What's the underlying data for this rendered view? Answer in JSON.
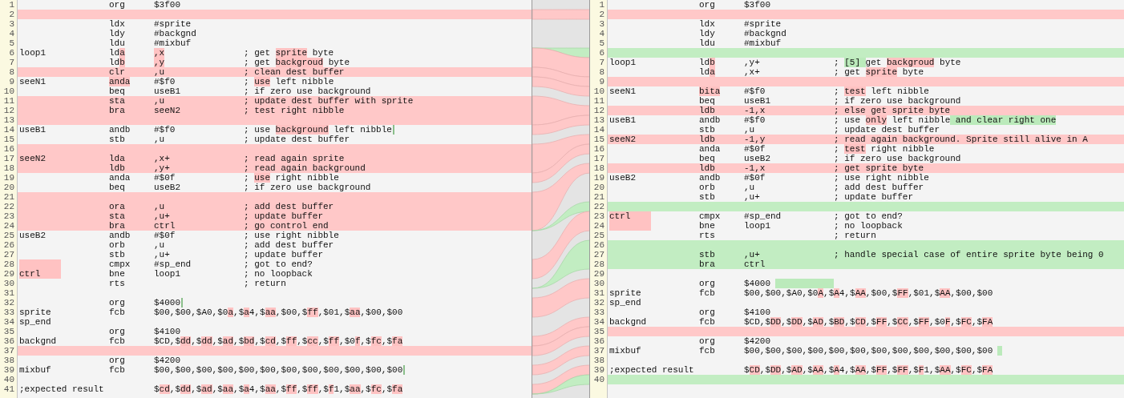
{
  "left": {
    "lines": [
      {
        "n": "1",
        "changed": false,
        "inserted": false,
        "op": "org",
        "arg": "$3f00"
      },
      {
        "n": "2",
        "changed": true,
        "inserted": false
      },
      {
        "n": "3",
        "changed": false,
        "inserted": false,
        "op": "ldx",
        "arg": "#sprite"
      },
      {
        "n": "4",
        "changed": false,
        "inserted": false,
        "op": "ldy",
        "arg": "#backgnd"
      },
      {
        "n": "5",
        "changed": false,
        "inserted": false,
        "op": "ldu",
        "arg": "#mixbuf"
      },
      {
        "n": "6",
        "changed": false,
        "inserted": false,
        "label": "loop1",
        "op": [
          "ld",
          {
            "text": "a",
            "inserted": false
          }
        ],
        "arg": [
          {
            "text": ",x",
            "inserted": false
          }
        ],
        "comment": [
          "; get ",
          {
            "text": "sprite",
            "inserted": false
          },
          " byte"
        ]
      },
      {
        "n": "7",
        "changed": false,
        "inserted": false,
        "op": [
          "ld",
          {
            "text": "b",
            "inserted": false
          }
        ],
        "arg": [
          {
            "text": ",y",
            "inserted": false
          }
        ],
        "comment": [
          "; get ",
          {
            "text": "backgroud",
            "inserted": false
          },
          " byte"
        ]
      },
      {
        "n": "8",
        "changed": true,
        "inserted": false,
        "op": "clr",
        "arg": ",u",
        "comment": "; clean dest buffer"
      },
      {
        "n": "9",
        "changed": false,
        "inserted": false,
        "label": "seeN1",
        "op": [
          {
            "text": "anda",
            "inserted": false
          }
        ],
        "arg": "#$f0",
        "comment": [
          "; ",
          {
            "text": "use",
            "inserted": false
          },
          " left nibble"
        ]
      },
      {
        "n": "10",
        "changed": false,
        "inserted": false,
        "op": "beq",
        "arg": "useB1",
        "comment": "; if zero use background"
      },
      {
        "n": "11",
        "changed": true,
        "inserted": false,
        "op": "sta",
        "arg": ",u",
        "comment": "; update dest buffer with sprite"
      },
      {
        "n": "12",
        "changed": true,
        "inserted": false,
        "op": "bra",
        "arg": "seeN2",
        "comment": "; test right nibble"
      },
      {
        "n": "13",
        "changed": true,
        "inserted": false
      },
      {
        "n": "14",
        "changed": false,
        "inserted": false,
        "label": "useB1",
        "op": "andb",
        "arg": "#$f0",
        "comment": [
          "; use ",
          {
            "text": "background",
            "inserted": false
          },
          " left nibble"
        ],
        "caret": true
      },
      {
        "n": "15",
        "changed": false,
        "inserted": false,
        "op": "stb",
        "arg": ",u",
        "comment": "; update dest buffer"
      },
      {
        "n": "16",
        "changed": true,
        "inserted": false
      },
      {
        "n": "17",
        "changed": true,
        "inserted": false,
        "label": "seeN2",
        "op": "lda",
        "arg": ",x+",
        "comment": "; read again sprite"
      },
      {
        "n": "18",
        "changed": true,
        "inserted": false,
        "op": "ldb",
        "arg": ",y+",
        "comment": "; read again background"
      },
      {
        "n": "19",
        "changed": false,
        "inserted": false,
        "op": "anda",
        "arg": "#$0f",
        "comment": [
          "; ",
          {
            "text": "use",
            "inserted": false
          },
          " right nibble"
        ]
      },
      {
        "n": "20",
        "changed": false,
        "inserted": false,
        "op": "beq",
        "arg": "useB2",
        "comment": "; if zero use background"
      },
      {
        "n": "21",
        "changed": true,
        "inserted": false
      },
      {
        "n": "22",
        "changed": true,
        "inserted": false,
        "op": "ora",
        "arg": ",u",
        "comment": "; add dest buffer"
      },
      {
        "n": "23",
        "changed": true,
        "inserted": false,
        "op": "sta",
        "arg": ",u+",
        "comment": "; update buffer"
      },
      {
        "n": "24",
        "changed": true,
        "inserted": false,
        "op": "bra",
        "arg": "ctrl",
        "comment": "; go control end"
      },
      {
        "n": "25",
        "changed": false,
        "inserted": false,
        "label": "useB2",
        "op": "andb",
        "arg": "#$0f",
        "comment": "; use right nibble"
      },
      {
        "n": "26",
        "changed": false,
        "inserted": false,
        "op": "orb",
        "arg": ",u",
        "comment": "; add dest buffer"
      },
      {
        "n": "27",
        "changed": false,
        "inserted": false,
        "op": "stb",
        "arg": ",u+",
        "comment": "; update buffer"
      },
      {
        "n": "28",
        "changed": false,
        "inserted": false,
        "label_highlight": true,
        "op": "cmpx",
        "arg": "#sp_end",
        "comment": "; got to end?"
      },
      {
        "n": "29",
        "changed": false,
        "inserted": false,
        "label_highlight": true,
        "label": "ctrl",
        "op": "bne",
        "arg": "loop1",
        "comment": "; no loopback"
      },
      {
        "n": "30",
        "changed": false,
        "inserted": false,
        "op": "rts",
        "comment": "; return"
      },
      {
        "n": "31",
        "changed": false,
        "inserted": false
      },
      {
        "n": "32",
        "changed": false,
        "inserted": false,
        "op": "org",
        "arg": "$4000",
        "caret": true
      },
      {
        "n": "33",
        "changed": false,
        "inserted": false,
        "label": "sprite",
        "op": "fcb",
        "arg": [
          "$00,$00,$A0,$0",
          {
            "text": "a",
            "inserted": false
          },
          ",$",
          {
            "text": "a",
            "inserted": false
          },
          "4,$",
          {
            "text": "aa",
            "inserted": false
          },
          ",$00,$",
          {
            "text": "ff",
            "inserted": false
          },
          ",$01,$",
          {
            "text": "aa",
            "inserted": false
          },
          ",$00,$00"
        ]
      },
      {
        "n": "34",
        "changed": false,
        "inserted": false,
        "label": "sp_end"
      },
      {
        "n": "35",
        "changed": false,
        "inserted": false,
        "op": "org",
        "arg": "$4100"
      },
      {
        "n": "36",
        "changed": false,
        "inserted": false,
        "label": "backgnd",
        "op": "fcb",
        "arg": [
          "$CD,$",
          {
            "text": "dd",
            "inserted": false
          },
          ",$",
          {
            "text": "dd",
            "inserted": false
          },
          ",$",
          {
            "text": "ad",
            "inserted": false
          },
          ",$",
          {
            "text": "bd",
            "inserted": false
          },
          ",$",
          {
            "text": "cd",
            "inserted": false
          },
          ",$",
          {
            "text": "ff",
            "inserted": false
          },
          ",$",
          {
            "text": "cc",
            "inserted": false
          },
          ",$",
          {
            "text": "ff",
            "inserted": false
          },
          ",$0",
          {
            "text": "f",
            "inserted": false
          },
          ",$",
          {
            "text": "fc",
            "inserted": false
          },
          ",$",
          {
            "text": "fa",
            "inserted": false
          }
        ]
      },
      {
        "n": "37",
        "changed": true,
        "inserted": false
      },
      {
        "n": "38",
        "changed": false,
        "inserted": false,
        "op": "org",
        "arg": "$4200"
      },
      {
        "n": "39",
        "changed": false,
        "inserted": false,
        "label": "mixbuf",
        "op": "fcb",
        "arg": "$00,$00,$00,$00,$00,$00,$00,$00,$00,$00,$00,$00",
        "caret": true
      },
      {
        "n": "40",
        "changed": false,
        "inserted": false
      },
      {
        "n": "41",
        "changed": false,
        "inserted": false,
        "label": ";expected result",
        "arg": [
          "$",
          {
            "text": "cd",
            "inserted": false
          },
          ",$",
          {
            "text": "dd",
            "inserted": false
          },
          ",$",
          {
            "text": "ad",
            "inserted": false
          },
          ",$",
          {
            "text": "aa",
            "inserted": false
          },
          ",$",
          {
            "text": "a",
            "inserted": false
          },
          "4,$",
          {
            "text": "aa",
            "inserted": false
          },
          ",$",
          {
            "text": "ff",
            "inserted": false
          },
          ",$",
          {
            "text": "ff",
            "inserted": false
          },
          ",$",
          {
            "text": "f",
            "inserted": false
          },
          "1,$",
          {
            "text": "aa",
            "inserted": false
          },
          ",$",
          {
            "text": "fc",
            "inserted": false
          },
          ",$",
          {
            "text": "fa",
            "inserted": false
          }
        ]
      }
    ]
  },
  "right": {
    "lines": [
      {
        "n": "1",
        "changed": false,
        "inserted": false,
        "op": "org",
        "arg": "$3f00"
      },
      {
        "n": "2",
        "changed": true,
        "inserted": false
      },
      {
        "n": "3",
        "changed": false,
        "inserted": false,
        "op": "ldx",
        "arg": "#sprite"
      },
      {
        "n": "4",
        "changed": false,
        "inserted": false,
        "op": "ldy",
        "arg": "#backgnd"
      },
      {
        "n": "5",
        "changed": false,
        "inserted": false,
        "op": "ldu",
        "arg": "#mixbuf"
      },
      {
        "n": "6",
        "changed": false,
        "inserted": true
      },
      {
        "n": "7",
        "changed": false,
        "inserted": false,
        "label": "loop1",
        "op": [
          "ld",
          {
            "text": "b",
            "inserted": false
          }
        ],
        "arg": ",y+",
        "comment": [
          "; ",
          {
            "text": "[5] ",
            "inserted": true
          },
          "get ",
          {
            "text": "backgroud",
            "inserted": false
          },
          " byte"
        ]
      },
      {
        "n": "8",
        "changed": false,
        "inserted": false,
        "op": [
          "ld",
          {
            "text": "a",
            "inserted": false
          }
        ],
        "arg": ",x+",
        "comment": [
          "; get ",
          {
            "text": "sprite",
            "inserted": false
          },
          " byte"
        ]
      },
      {
        "n": "9",
        "changed": true,
        "inserted": false
      },
      {
        "n": "10",
        "changed": false,
        "inserted": false,
        "label": "seeN1",
        "op": [
          {
            "text": "bita",
            "inserted": false
          }
        ],
        "arg": "#$f0",
        "comment": [
          "; ",
          {
            "text": "test",
            "inserted": false
          },
          " left nibble"
        ]
      },
      {
        "n": "11",
        "changed": false,
        "inserted": false,
        "op": "beq",
        "arg": "useB1",
        "comment": "; if zero use background"
      },
      {
        "n": "12",
        "changed": true,
        "inserted": false,
        "op": "ldb",
        "arg": "-1,x",
        "comment": "; else get sprite byte"
      },
      {
        "n": "13",
        "changed": false,
        "inserted": false,
        "label": "useB1",
        "op": "andb",
        "arg": "#$f0",
        "comment": [
          "; use ",
          {
            "text": "only",
            "inserted": false
          },
          " left nibble",
          {
            "text": " and clear right one",
            "inserted": true
          }
        ]
      },
      {
        "n": "14",
        "changed": false,
        "inserted": false,
        "op": "stb",
        "arg": ",u",
        "comment": "; update dest buffer"
      },
      {
        "n": "15",
        "changed": true,
        "inserted": false,
        "label": "seeN2",
        "op": "ldb",
        "arg": "-1,y",
        "comment": "; read again background. Sprite still alive in A"
      },
      {
        "n": "16",
        "changed": false,
        "inserted": false,
        "op": "anda",
        "arg": "#$0f",
        "comment": [
          "; ",
          {
            "text": "test",
            "inserted": false
          },
          " right nibble"
        ]
      },
      {
        "n": "17",
        "changed": false,
        "inserted": false,
        "op": "beq",
        "arg": "useB2",
        "comment": "; if zero use background"
      },
      {
        "n": "18",
        "changed": true,
        "inserted": false,
        "op": "ldb",
        "arg": "-1,x",
        "comment": "; get sprite byte"
      },
      {
        "n": "19",
        "changed": false,
        "inserted": false,
        "label": "useB2",
        "op": "andb",
        "arg": "#$0f",
        "comment": "; use right nibble"
      },
      {
        "n": "20",
        "changed": false,
        "inserted": false,
        "op": "orb",
        "arg": ",u",
        "comment": "; add dest buffer"
      },
      {
        "n": "21",
        "changed": false,
        "inserted": false,
        "op": "stb",
        "arg": ",u+",
        "comment": "; update buffer"
      },
      {
        "n": "22",
        "changed": false,
        "inserted": true
      },
      {
        "n": "23",
        "changed": false,
        "inserted": false,
        "label_highlight": true,
        "label": "ctrl",
        "op": "cmpx",
        "arg": "#sp_end",
        "comment": "; got to end?"
      },
      {
        "n": "24",
        "changed": false,
        "inserted": false,
        "label_highlight": true,
        "op": "bne",
        "arg": "loop1",
        "comment": "; no loopback"
      },
      {
        "n": "25",
        "changed": false,
        "inserted": false,
        "op": "rts",
        "comment": "; return"
      },
      {
        "n": "26",
        "changed": false,
        "inserted": true
      },
      {
        "n": "27",
        "changed": false,
        "inserted": true,
        "op": "stb",
        "arg": ",u+",
        "comment": "; handle special case of entire sprite byte being 0"
      },
      {
        "n": "28",
        "changed": false,
        "inserted": true,
        "op": "bra",
        "arg": "ctrl"
      },
      {
        "n": "29",
        "changed": false,
        "inserted": false
      },
      {
        "n": "30",
        "changed": false,
        "inserted": false,
        "op": "org",
        "arg": "$4000",
        "inserted_gap": true
      },
      {
        "n": "31",
        "changed": false,
        "inserted": false,
        "label": "sprite",
        "op": "fcb",
        "arg": [
          "$00,$00,$A0,$0",
          {
            "text": "A",
            "inserted": false
          },
          ",$",
          {
            "text": "A",
            "inserted": false
          },
          "4,$",
          {
            "text": "AA",
            "inserted": false
          },
          ",$00,$",
          {
            "text": "FF",
            "inserted": false
          },
          ",$01,$",
          {
            "text": "AA",
            "inserted": false
          },
          ",$00,$00"
        ]
      },
      {
        "n": "32",
        "changed": false,
        "inserted": false,
        "label": "sp_end"
      },
      {
        "n": "33",
        "changed": false,
        "inserted": false,
        "op": "org",
        "arg": "$4100"
      },
      {
        "n": "34",
        "changed": false,
        "inserted": false,
        "label": "backgnd",
        "op": "fcb",
        "arg": [
          "$CD,$",
          {
            "text": "DD",
            "inserted": false
          },
          ",$",
          {
            "text": "DD",
            "inserted": false
          },
          ",$",
          {
            "text": "AD",
            "inserted": false
          },
          ",$",
          {
            "text": "BD",
            "inserted": false
          },
          ",$",
          {
            "text": "CD",
            "inserted": false
          },
          ",$",
          {
            "text": "FF",
            "inserted": false
          },
          ",$",
          {
            "text": "CC",
            "inserted": false
          },
          ",$",
          {
            "text": "FF",
            "inserted": false
          },
          ",$0",
          {
            "text": "F",
            "inserted": false
          },
          ",$",
          {
            "text": "FC",
            "inserted": false
          },
          ",$",
          {
            "text": "FA",
            "inserted": false
          }
        ]
      },
      {
        "n": "35",
        "changed": true,
        "inserted": false
      },
      {
        "n": "36",
        "changed": false,
        "inserted": false,
        "op": "org",
        "arg": "$4200"
      },
      {
        "n": "37",
        "changed": false,
        "inserted": false,
        "label": "mixbuf",
        "op": "fcb",
        "arg": "$00,$00,$00,$00,$00,$00,$00,$00,$00,$00,$00,$00",
        "inserted_gap": true
      },
      {
        "n": "38",
        "changed": false,
        "inserted": false
      },
      {
        "n": "39",
        "changed": false,
        "inserted": false,
        "label": ";expected result",
        "arg": [
          "$",
          {
            "text": "CD",
            "inserted": false
          },
          ",$",
          {
            "text": "DD",
            "inserted": false
          },
          ",$",
          {
            "text": "AD",
            "inserted": false
          },
          ",$",
          {
            "text": "AA",
            "inserted": false
          },
          ",$",
          {
            "text": "A",
            "inserted": false
          },
          "4,$",
          {
            "text": "AA",
            "inserted": false
          },
          ",$",
          {
            "text": "FF",
            "inserted": false
          },
          ",$",
          {
            "text": "FF",
            "inserted": false
          },
          ",$",
          {
            "text": "F",
            "inserted": false
          },
          "1,$",
          {
            "text": "AA",
            "inserted": false
          },
          ",$",
          {
            "text": "FC",
            "inserted": false
          },
          ",$",
          {
            "text": "FA",
            "inserted": false
          }
        ]
      },
      {
        "n": "40",
        "changed": false,
        "inserted": true
      }
    ]
  }
}
